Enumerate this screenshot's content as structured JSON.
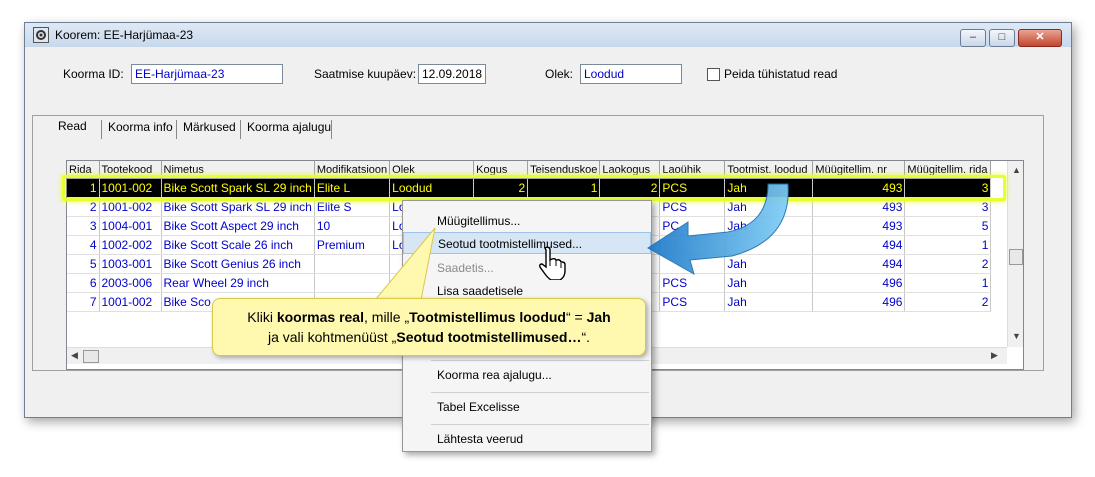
{
  "window": {
    "title": "Koorem: EE-Harjümaa-23",
    "minimize": "–",
    "maximize": "□",
    "close": "✕"
  },
  "form": {
    "koorma_id_label": "Koorma ID:",
    "koorma_id_value": "EE-Harjümaa-23",
    "saatmise_label": "Saatmise kuupäev:",
    "saatmise_value": "12.09.2018",
    "olek_label": "Olek:",
    "olek_value": "Loodud",
    "peida_label": "Peida tühistatud read"
  },
  "tabs": [
    "Read",
    "Koorma info",
    "Märkused",
    "Koorma ajalugu"
  ],
  "grid": {
    "columns": [
      "Rida",
      "Tootekood",
      "Nimetus",
      "Modifikatsioon",
      "Olek",
      "Kogus",
      "Teisenduskoe",
      "Laokogus",
      "Laoühik",
      "Tootmist. loodud",
      "Müügitellim. nr",
      "Müügitellim. rida"
    ],
    "rows": [
      [
        "1",
        "1001-002",
        "Bike Scott Spark SL 29 inch",
        "Elite L",
        "Loodud",
        "2",
        "1",
        "2",
        "PCS",
        "Jah",
        "493",
        "3"
      ],
      [
        "2",
        "1001-002",
        "Bike Scott Spark SL 29 inch",
        "Elite S",
        "Lo",
        "",
        "",
        "",
        "PCS",
        "Jah",
        "493",
        "3"
      ],
      [
        "3",
        "1004-001",
        "Bike Scott Aspect 29 inch",
        "10",
        "Lo",
        "",
        "",
        "",
        "PC",
        "Jah",
        "493",
        "5"
      ],
      [
        "4",
        "1002-002",
        "Bike Scott Scale 26 inch",
        "Premium",
        "Lo",
        "",
        "",
        "",
        "",
        "",
        "494",
        "1"
      ],
      [
        "5",
        "1003-001",
        "Bike Scott Genius 26 inch",
        "",
        "",
        "",
        "",
        "",
        "",
        "Jah",
        "494",
        "2"
      ],
      [
        "6",
        "2003-006",
        "Rear Wheel 29 inch",
        "",
        "",
        "",
        "",
        "",
        "PCS",
        "Jah",
        "496",
        "1"
      ],
      [
        "7",
        "1001-002",
        "Bike Sco",
        "",
        "",
        "",
        "",
        "",
        "PCS",
        "Jah",
        "496",
        "2"
      ]
    ]
  },
  "context_menu": {
    "items": [
      {
        "label": "Müügitellimus...",
        "state": "normal"
      },
      {
        "label": "Seotud tootmistellimused...",
        "state": "hover"
      },
      {
        "label": "Saadetis...",
        "state": "disabled"
      },
      {
        "label": "Lisa saadetisele",
        "state": "normal"
      },
      {
        "label": "Koorma rea ajalugu...",
        "state": "normal"
      },
      {
        "label": "Tabel Excelisse",
        "state": "normal"
      },
      {
        "label": "Lähtesta veerud",
        "state": "normal"
      }
    ]
  },
  "callout": {
    "p1": "Kliki ",
    "b1": "koormas real",
    "p2": ", mille „",
    "b2": "Tootmistellimus loodud",
    "p3": "“ = ",
    "b3": "Jah",
    "p4": "ja vali kohtmenüüst „",
    "b4": "Seotud tootmistellimused…",
    "p5": "“."
  },
  "colors": {
    "highlight": "#e6ff33",
    "callout_bg": "#fff9b0",
    "arrow": "#3aa0e0",
    "link_text": "#0000cc"
  }
}
